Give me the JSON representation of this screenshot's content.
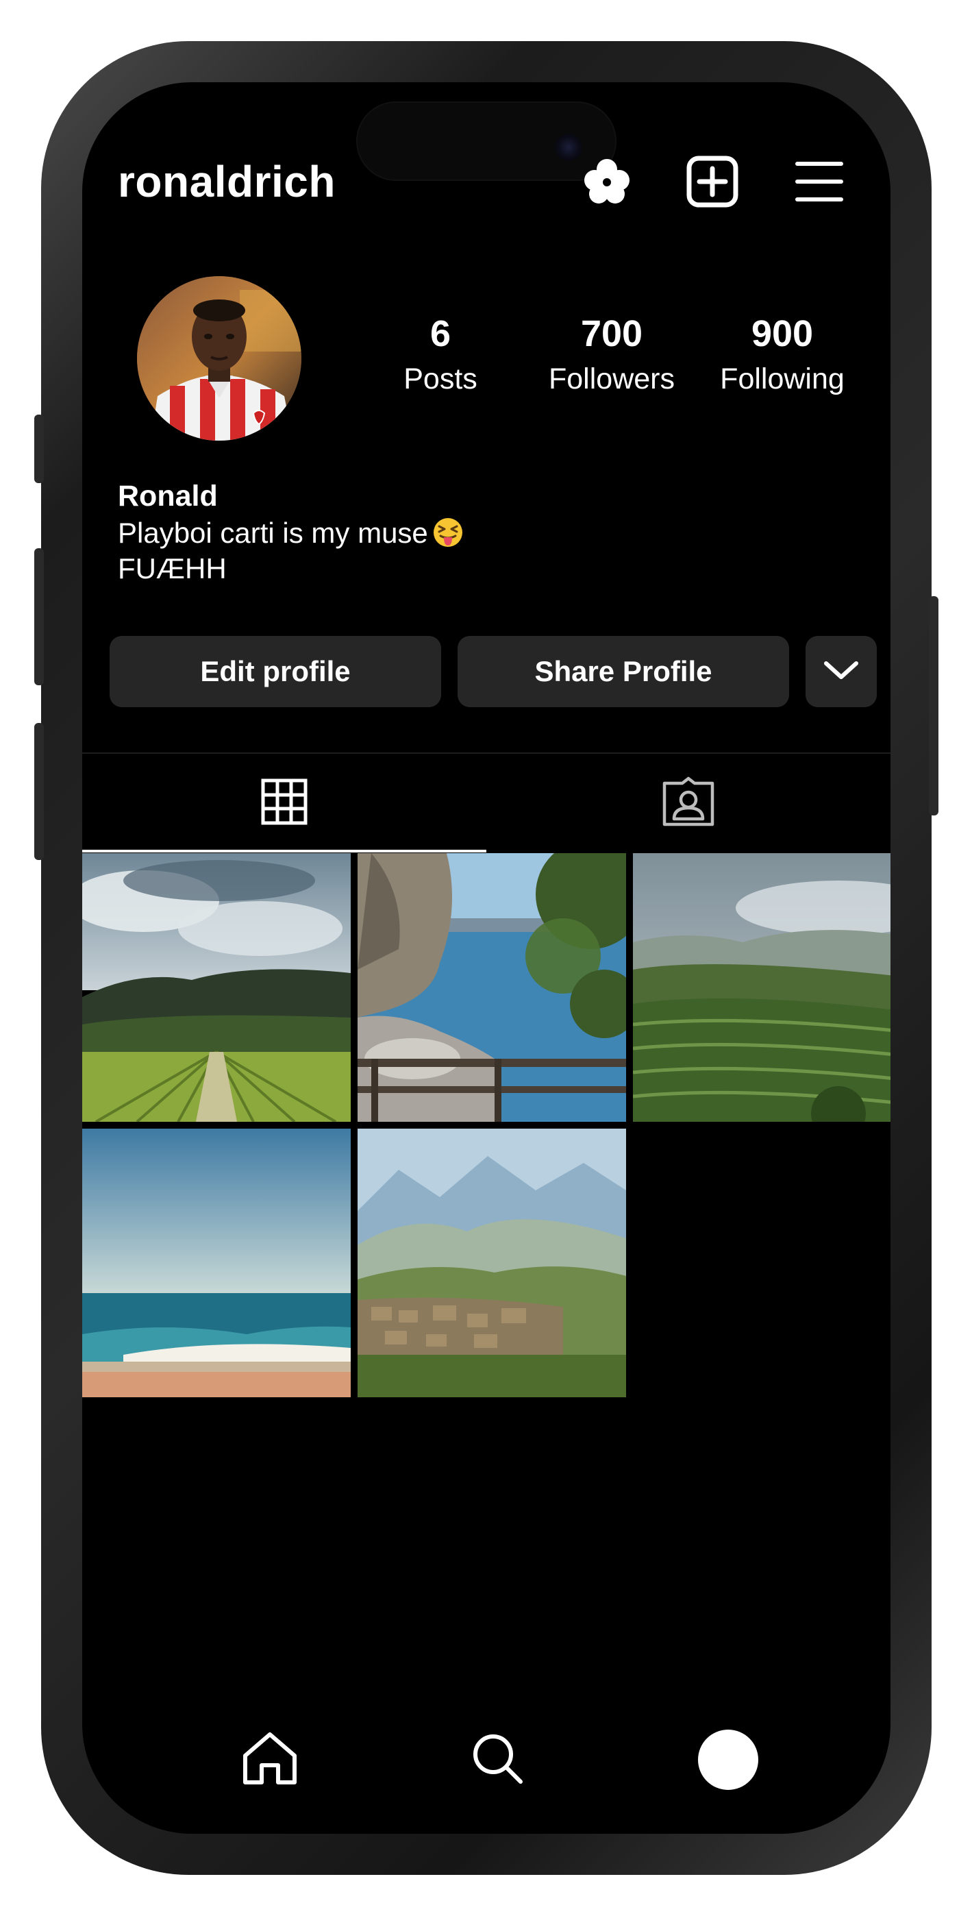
{
  "header": {
    "username": "ronaldrich",
    "icons": [
      "threads-icon",
      "add-post-icon",
      "menu-icon"
    ]
  },
  "profile": {
    "stats": [
      {
        "value": "6",
        "label": "Posts"
      },
      {
        "value": "700",
        "label": "Followers"
      },
      {
        "value": "900",
        "label": "Following"
      }
    ],
    "name": "Ronald",
    "bio_line1": "Playboi carti is my muse",
    "bio_emoji": "squinting-face-with-tongue-emoji",
    "bio_line2": "FUÆHH"
  },
  "actions": {
    "edit_label": "Edit profile",
    "share_label": "Share Profile",
    "more_icon": "chevron-down-icon"
  },
  "tabs": [
    {
      "icon": "grid-icon",
      "active": true
    },
    {
      "icon": "tagged-icon",
      "active": false
    }
  ],
  "posts": [
    {
      "subject": "vineyard rows under cloudy sky"
    },
    {
      "subject": "rocky sea coast with railing"
    },
    {
      "subject": "green terraced mountain slopes"
    },
    {
      "subject": "sea waves on sandy beach"
    },
    {
      "subject": "mountain village ruins"
    }
  ],
  "bottom_nav": [
    "home-icon",
    "search-icon",
    "profile-avatar"
  ],
  "colors": {
    "background": "#000000",
    "button_bg": "#262626",
    "text": "#ffffff"
  }
}
